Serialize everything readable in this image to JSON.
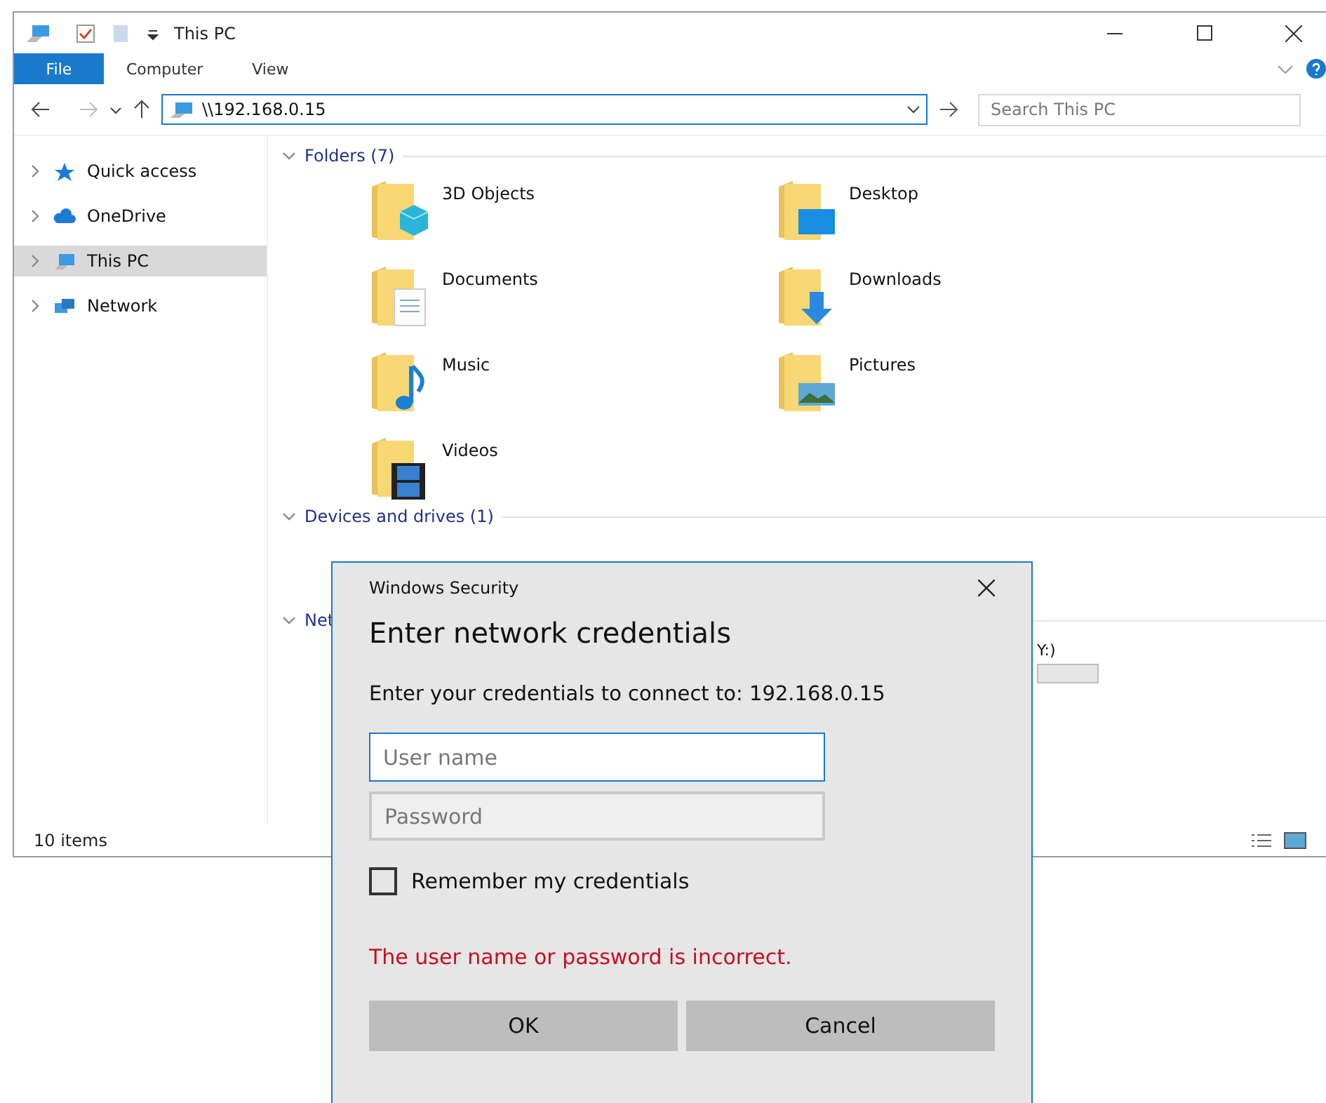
{
  "window": {
    "title": "This PC"
  },
  "ribbon": {
    "tabs": [
      {
        "label": "File",
        "selected": true
      },
      {
        "label": "Computer",
        "selected": false
      },
      {
        "label": "View",
        "selected": false
      }
    ]
  },
  "address": {
    "path": "\\\\192.168.0.15"
  },
  "search": {
    "placeholder": "Search This PC"
  },
  "sidebar": {
    "items": [
      {
        "label": "Quick access",
        "kind": "star",
        "selected": false,
        "expanded": false
      },
      {
        "label": "OneDrive",
        "kind": "cloud",
        "selected": false,
        "expanded": false
      },
      {
        "label": "This PC",
        "kind": "pc",
        "selected": true,
        "expanded": false
      },
      {
        "label": "Network",
        "kind": "network",
        "selected": false,
        "expanded": false
      }
    ]
  },
  "sections": [
    {
      "title": "Folders (7)",
      "expanded": true,
      "items": [
        {
          "name": "3D Objects",
          "kind": "cube"
        },
        {
          "name": "Desktop",
          "kind": "desktop"
        },
        {
          "name": "Documents",
          "kind": "document"
        },
        {
          "name": "Downloads",
          "kind": "download"
        },
        {
          "name": "Music",
          "kind": "music"
        },
        {
          "name": "Pictures",
          "kind": "picture"
        },
        {
          "name": "Videos",
          "kind": "video"
        }
      ]
    },
    {
      "title": "Devices and drives (1)",
      "expanded": true
    },
    {
      "title": "Net",
      "expanded": true
    }
  ],
  "drive": {
    "label": "Y:)"
  },
  "status_bar": {
    "count": "10 items"
  },
  "dialog": {
    "title": "Windows Security",
    "heading": "Enter network credentials",
    "message": "Enter your credentials to connect to: 192.168.0.15",
    "username": {
      "placeholder": "User name"
    },
    "password": {
      "placeholder": "Password"
    },
    "remember": {
      "label": "Remember my credentials",
      "checked": false
    },
    "error": "The user name or password is incorrect.",
    "buttons": [
      "OK",
      "Cancel"
    ]
  }
}
